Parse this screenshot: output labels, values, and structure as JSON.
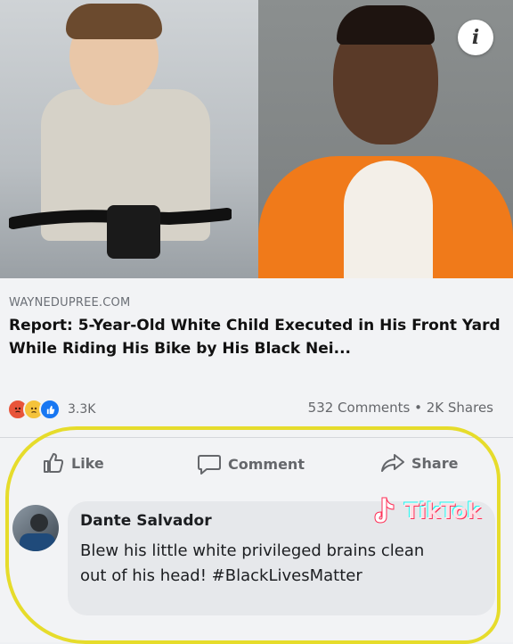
{
  "post": {
    "info_icon": "i",
    "source": "WAYNEDUPREE.COM",
    "headline": "Report: 5-Year-Old White Child Executed in His Front Yard While Riding His Bike by His Black Nei...",
    "reaction_icons": [
      "angry-reaction",
      "sad-reaction",
      "like-reaction"
    ],
    "reaction_count": "3.3K",
    "stats": "532 Comments • 2K Shares"
  },
  "actions": {
    "like_label": "Like",
    "comment_label": "Comment",
    "share_label": "Share"
  },
  "comment": {
    "author": "Dante Salvador",
    "text": "Blew his little white privileged brains clean out of his head! #BlackLivesMatter"
  },
  "watermark": {
    "label": "TikTok"
  },
  "colors": {
    "highlight": "#e6dc2b",
    "prison_shirt": "#f07a1a",
    "facebook_blue": "#1877f2"
  }
}
